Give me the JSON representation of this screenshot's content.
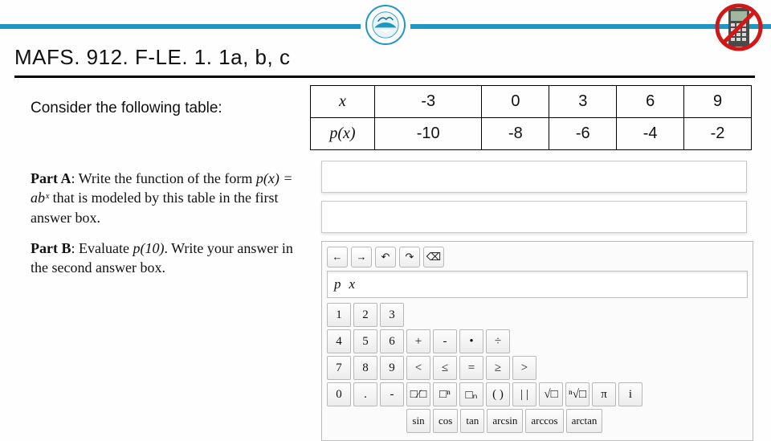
{
  "standard_code": "MAFS. 912. F-LE. 1. 1a, b, c",
  "prompt": "Consider the following table:",
  "table": {
    "row1_label": "x",
    "row2_label": "p(x)",
    "row1": [
      "-3",
      "0",
      "3",
      "6",
      "9"
    ],
    "row2": [
      "-10",
      "-8",
      "-6",
      "-4",
      "-2"
    ]
  },
  "parts": {
    "a_label": "Part A",
    "a_text_1": ": Write the function of the form ",
    "a_math": "p(x) = abˣ",
    "a_text_2": "that is modeled by this table in the first answer box.",
    "b_label": "Part B",
    "b_text_1": ": Evaluate ",
    "b_math": "p(10)",
    "b_text_2": ". Write your answer in the second answer box."
  },
  "keypad": {
    "toolbar": [
      "←",
      "→",
      "↶",
      "↷",
      "⌫"
    ],
    "entry_tokens": [
      "p",
      "x"
    ],
    "rows": [
      [
        "1",
        "2",
        "3"
      ],
      [
        "4",
        "5",
        "6",
        "+",
        "-",
        "•",
        "÷"
      ],
      [
        "7",
        "8",
        "9",
        "<",
        "≤",
        "=",
        "≥",
        ">"
      ],
      [
        "0",
        ".",
        "-",
        "□⁄□",
        "□ⁿ",
        "□ₙ",
        "( )",
        "| |",
        "√□",
        "ⁿ√□",
        "π",
        "i"
      ],
      [
        "sin",
        "cos",
        "tan",
        "arcsin",
        "arccos",
        "arctan"
      ]
    ]
  },
  "chart_data": {
    "type": "table",
    "title": "Function values table",
    "columns": [
      "x",
      "p(x)"
    ],
    "rows": [
      [
        -3,
        -10
      ],
      [
        0,
        -8
      ],
      [
        3,
        -6
      ],
      [
        6,
        -4
      ],
      [
        9,
        -2
      ]
    ]
  }
}
